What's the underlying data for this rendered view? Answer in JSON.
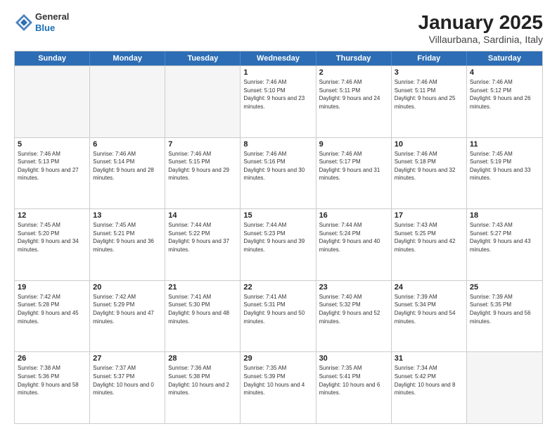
{
  "header": {
    "logo": {
      "line1": "General",
      "line2": "Blue"
    },
    "title": "January 2025",
    "subtitle": "Villaurbana, Sardinia, Italy"
  },
  "days_of_week": [
    "Sunday",
    "Monday",
    "Tuesday",
    "Wednesday",
    "Thursday",
    "Friday",
    "Saturday"
  ],
  "weeks": [
    [
      {
        "day": "",
        "empty": true
      },
      {
        "day": "",
        "empty": true
      },
      {
        "day": "",
        "empty": true
      },
      {
        "day": "1",
        "sunrise": "7:46 AM",
        "sunset": "5:10 PM",
        "daylight": "9 hours and 23 minutes."
      },
      {
        "day": "2",
        "sunrise": "7:46 AM",
        "sunset": "5:11 PM",
        "daylight": "9 hours and 24 minutes."
      },
      {
        "day": "3",
        "sunrise": "7:46 AM",
        "sunset": "5:11 PM",
        "daylight": "9 hours and 25 minutes."
      },
      {
        "day": "4",
        "sunrise": "7:46 AM",
        "sunset": "5:12 PM",
        "daylight": "9 hours and 26 minutes."
      }
    ],
    [
      {
        "day": "5",
        "sunrise": "7:46 AM",
        "sunset": "5:13 PM",
        "daylight": "9 hours and 27 minutes."
      },
      {
        "day": "6",
        "sunrise": "7:46 AM",
        "sunset": "5:14 PM",
        "daylight": "9 hours and 28 minutes."
      },
      {
        "day": "7",
        "sunrise": "7:46 AM",
        "sunset": "5:15 PM",
        "daylight": "9 hours and 29 minutes."
      },
      {
        "day": "8",
        "sunrise": "7:46 AM",
        "sunset": "5:16 PM",
        "daylight": "9 hours and 30 minutes."
      },
      {
        "day": "9",
        "sunrise": "7:46 AM",
        "sunset": "5:17 PM",
        "daylight": "9 hours and 31 minutes."
      },
      {
        "day": "10",
        "sunrise": "7:46 AM",
        "sunset": "5:18 PM",
        "daylight": "9 hours and 32 minutes."
      },
      {
        "day": "11",
        "sunrise": "7:45 AM",
        "sunset": "5:19 PM",
        "daylight": "9 hours and 33 minutes."
      }
    ],
    [
      {
        "day": "12",
        "sunrise": "7:45 AM",
        "sunset": "5:20 PM",
        "daylight": "9 hours and 34 minutes."
      },
      {
        "day": "13",
        "sunrise": "7:45 AM",
        "sunset": "5:21 PM",
        "daylight": "9 hours and 36 minutes."
      },
      {
        "day": "14",
        "sunrise": "7:44 AM",
        "sunset": "5:22 PM",
        "daylight": "9 hours and 37 minutes."
      },
      {
        "day": "15",
        "sunrise": "7:44 AM",
        "sunset": "5:23 PM",
        "daylight": "9 hours and 39 minutes."
      },
      {
        "day": "16",
        "sunrise": "7:44 AM",
        "sunset": "5:24 PM",
        "daylight": "9 hours and 40 minutes."
      },
      {
        "day": "17",
        "sunrise": "7:43 AM",
        "sunset": "5:25 PM",
        "daylight": "9 hours and 42 minutes."
      },
      {
        "day": "18",
        "sunrise": "7:43 AM",
        "sunset": "5:27 PM",
        "daylight": "9 hours and 43 minutes."
      }
    ],
    [
      {
        "day": "19",
        "sunrise": "7:42 AM",
        "sunset": "5:28 PM",
        "daylight": "9 hours and 45 minutes."
      },
      {
        "day": "20",
        "sunrise": "7:42 AM",
        "sunset": "5:29 PM",
        "daylight": "9 hours and 47 minutes."
      },
      {
        "day": "21",
        "sunrise": "7:41 AM",
        "sunset": "5:30 PM",
        "daylight": "9 hours and 48 minutes."
      },
      {
        "day": "22",
        "sunrise": "7:41 AM",
        "sunset": "5:31 PM",
        "daylight": "9 hours and 50 minutes."
      },
      {
        "day": "23",
        "sunrise": "7:40 AM",
        "sunset": "5:32 PM",
        "daylight": "9 hours and 52 minutes."
      },
      {
        "day": "24",
        "sunrise": "7:39 AM",
        "sunset": "5:34 PM",
        "daylight": "9 hours and 54 minutes."
      },
      {
        "day": "25",
        "sunrise": "7:39 AM",
        "sunset": "5:35 PM",
        "daylight": "9 hours and 56 minutes."
      }
    ],
    [
      {
        "day": "26",
        "sunrise": "7:38 AM",
        "sunset": "5:36 PM",
        "daylight": "9 hours and 58 minutes."
      },
      {
        "day": "27",
        "sunrise": "7:37 AM",
        "sunset": "5:37 PM",
        "daylight": "10 hours and 0 minutes."
      },
      {
        "day": "28",
        "sunrise": "7:36 AM",
        "sunset": "5:38 PM",
        "daylight": "10 hours and 2 minutes."
      },
      {
        "day": "29",
        "sunrise": "7:35 AM",
        "sunset": "5:39 PM",
        "daylight": "10 hours and 4 minutes."
      },
      {
        "day": "30",
        "sunrise": "7:35 AM",
        "sunset": "5:41 PM",
        "daylight": "10 hours and 6 minutes."
      },
      {
        "day": "31",
        "sunrise": "7:34 AM",
        "sunset": "5:42 PM",
        "daylight": "10 hours and 8 minutes."
      },
      {
        "day": "",
        "empty": true
      }
    ]
  ]
}
